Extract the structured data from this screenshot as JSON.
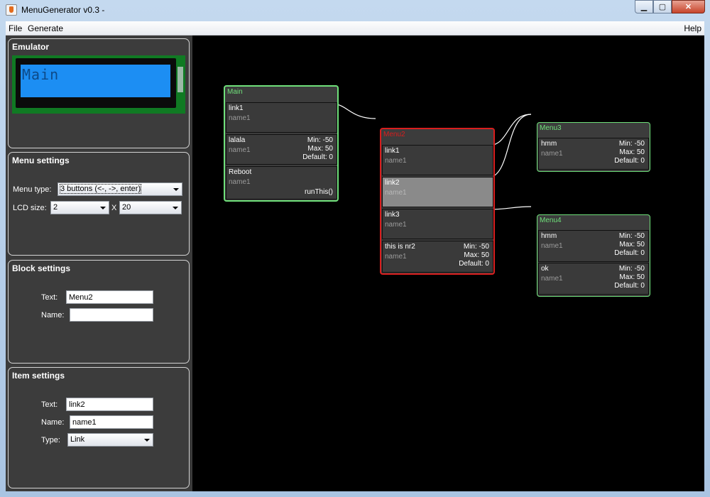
{
  "window": {
    "title": "MenuGenerator v0.3 -",
    "min_label": "▁",
    "max_label": "▢",
    "close_label": "✕"
  },
  "menubar": {
    "file": "File",
    "generate": "Generate",
    "help": "Help"
  },
  "emulator": {
    "title": "Emulator",
    "lcd_text": "Main"
  },
  "menu_settings": {
    "title": "Menu settings",
    "menu_type_label": "Menu type:",
    "menu_type_value": "3 buttons (<-, ->, enter)",
    "lcd_size_label": "LCD size:",
    "lcd_rows": "2",
    "lcd_x": "X",
    "lcd_cols": "20"
  },
  "block_settings": {
    "title": "Block settings",
    "text_label": "Text:",
    "text_value": "Menu2",
    "name_label": "Name:",
    "name_value": ""
  },
  "item_settings": {
    "title": "Item settings",
    "text_label": "Text:",
    "text_value": "link2",
    "name_label": "Name:",
    "name_value": "name1",
    "type_label": "Type:",
    "type_value": "Link"
  },
  "blocks": {
    "main": {
      "title": "Main",
      "items": [
        {
          "text": "link1",
          "name": "name1"
        },
        {
          "text": "lalala",
          "name": "name1",
          "min": "Min: -50",
          "max": "Max: 50",
          "def": "Default: 0"
        },
        {
          "text": "Reboot",
          "name": "name1",
          "action": "runThis()"
        }
      ]
    },
    "menu2": {
      "title": "Menu2",
      "items": [
        {
          "text": "link1",
          "name": "name1"
        },
        {
          "text": "link2",
          "name": "name1"
        },
        {
          "text": "link3",
          "name": "name1"
        },
        {
          "text": "this is nr2",
          "name": "name1",
          "min": "Min: -50",
          "max": "Max: 50",
          "def": "Default: 0"
        }
      ]
    },
    "menu3": {
      "title": "Menu3",
      "items": [
        {
          "text": "hmm",
          "name": "name1",
          "min": "Min: -50",
          "max": "Max: 50",
          "def": "Default: 0"
        }
      ]
    },
    "menu4": {
      "title": "Menu4",
      "items": [
        {
          "text": "hmm",
          "name": "name1",
          "min": "Min: -50",
          "max": "Max: 50",
          "def": "Default: 0"
        },
        {
          "text": "ok",
          "name": "name1",
          "min": "Min: -50",
          "max": "Max: 50",
          "def": "Default: 0"
        }
      ]
    }
  },
  "colors": {
    "block_border": "#6fe07a",
    "selected_border": "#d81e1e",
    "canvas": "#000000",
    "panel": "#3c3c3c"
  }
}
